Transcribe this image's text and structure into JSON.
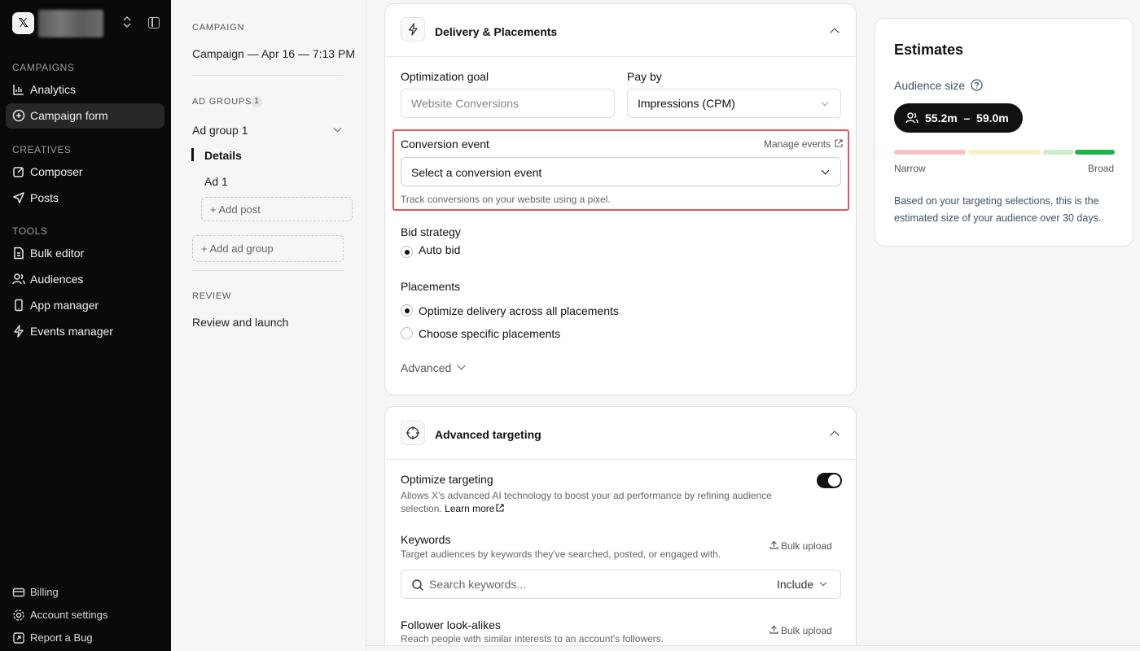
{
  "sidebar": {
    "sections": {
      "campaigns": "CAMPAIGNS",
      "creatives": "CREATIVES",
      "tools": "TOOLS"
    },
    "items": [
      {
        "label": "Analytics",
        "icon": "bar-chart-icon"
      },
      {
        "label": "Campaign form",
        "icon": "plus-circle-icon",
        "active": true
      },
      {
        "label": "Composer",
        "icon": "edit-icon"
      },
      {
        "label": "Posts",
        "icon": "send-icon"
      },
      {
        "label": "Bulk editor",
        "icon": "file-icon"
      },
      {
        "label": "Audiences",
        "icon": "users-icon"
      },
      {
        "label": "App manager",
        "icon": "phone-icon"
      },
      {
        "label": "Events manager",
        "icon": "bolt-icon"
      }
    ],
    "footer": [
      {
        "label": "Billing",
        "icon": "card-icon"
      },
      {
        "label": "Account settings",
        "icon": "gear-icon"
      },
      {
        "label": "Report a Bug",
        "icon": "bug-icon"
      }
    ]
  },
  "steps": {
    "campaign_label": "CAMPAIGN",
    "campaign_name": "Campaign — Apr 16 — 7:13 PM",
    "ad_groups_label": "AD GROUPS",
    "ad_groups_count": "1",
    "ad_group_name": "Ad group 1",
    "details": "Details",
    "ad": "Ad 1",
    "add_post": "Add post",
    "add_ad_group": "Add ad group",
    "review_label": "REVIEW",
    "review_launch": "Review and launch"
  },
  "delivery": {
    "title": "Delivery & Placements",
    "optimization_goal_label": "Optimization goal",
    "optimization_goal_value": "Website Conversions",
    "pay_by_label": "Pay by",
    "pay_by_value": "Impressions (CPM)",
    "conversion_event_label": "Conversion event",
    "manage_events": "Manage events",
    "conversion_event_value": "Select a conversion event",
    "conversion_help": "Track conversions on your website using a pixel.",
    "bid_strategy_label": "Bid strategy",
    "bid_auto": "Auto bid",
    "placements_label": "Placements",
    "placement_all": "Optimize delivery across all placements",
    "placement_specific": "Choose specific placements",
    "advanced": "Advanced"
  },
  "targeting": {
    "title": "Advanced targeting",
    "optimize_label": "Optimize targeting",
    "optimize_help": "Allows X's advanced AI technology to boost your ad performance by refining audience selection.",
    "learn_more": "Learn more",
    "optimize_on": true,
    "keywords_label": "Keywords",
    "keywords_help": "Target audiences by keywords they've searched, posted, or engaged with.",
    "bulk_upload": "Bulk upload",
    "keywords_placeholder": "Search keywords...",
    "include": "Include",
    "lookalikes_label": "Follower look-alikes",
    "lookalikes_help": "Reach people with similar interests to an account's followers.",
    "bulk_upload_2": "Bulk upload"
  },
  "estimates": {
    "title": "Estimates",
    "audience_label": "Audience size",
    "range": "55.2m  –  59.0m",
    "narrow": "Narrow",
    "broad": "Broad",
    "description": "Based on your targeting selections, this is the estimated size of your audience over 30 days.",
    "colors": {
      "red": "#f7c2c2",
      "yellow": "#faf0c8",
      "lightgreen": "#cdeecb",
      "green": "#1fb34b"
    }
  }
}
